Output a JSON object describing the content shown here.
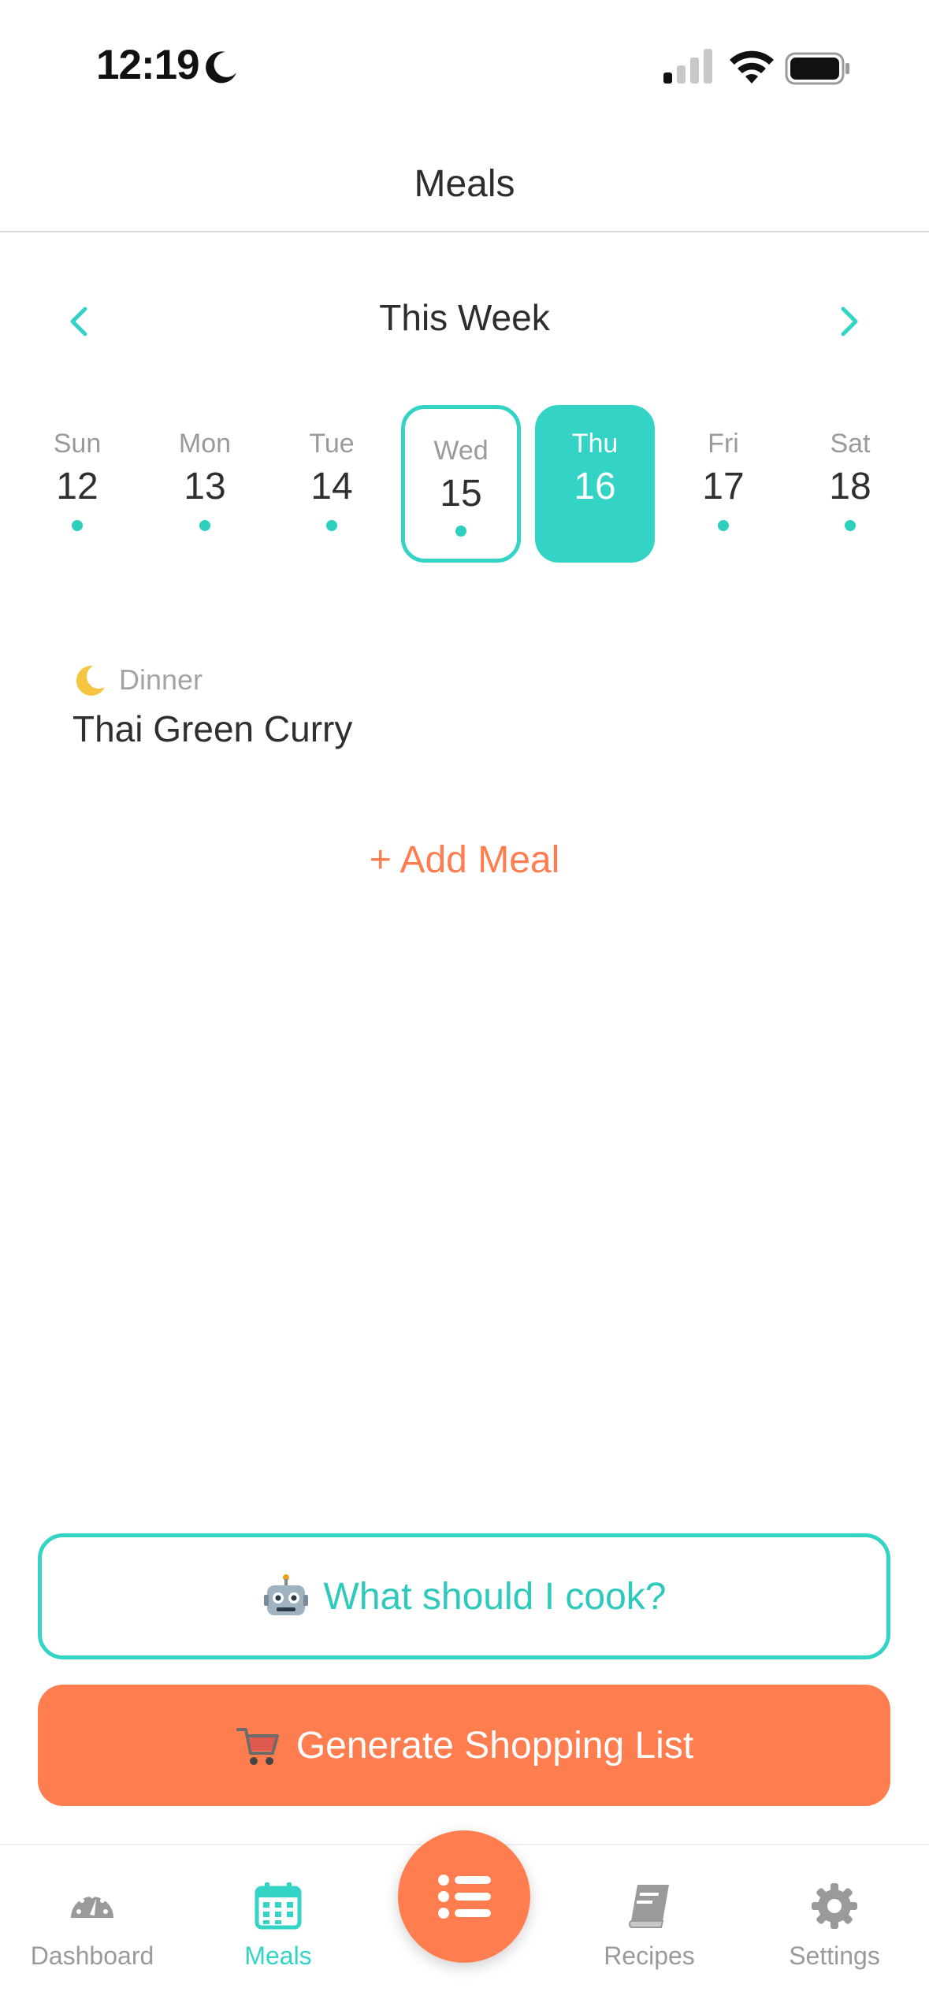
{
  "status_bar": {
    "time": "12:19"
  },
  "header": {
    "title": "Meals"
  },
  "week_nav": {
    "label": "This Week"
  },
  "days": [
    {
      "name": "Sun",
      "number": "12",
      "has_meal": true
    },
    {
      "name": "Mon",
      "number": "13",
      "has_meal": true
    },
    {
      "name": "Tue",
      "number": "14",
      "has_meal": true
    },
    {
      "name": "Wed",
      "number": "15",
      "has_meal": true,
      "today": true
    },
    {
      "name": "Thu",
      "number": "16",
      "has_meal": false,
      "selected": true
    },
    {
      "name": "Fri",
      "number": "17",
      "has_meal": true
    },
    {
      "name": "Sat",
      "number": "18",
      "has_meal": true
    }
  ],
  "meal": {
    "icon": "crescent-moon-icon",
    "type": "Dinner",
    "name": "Thai Green Curry"
  },
  "add_meal_label": "+ Add Meal",
  "actions": {
    "cook_label": "What should I cook?",
    "cook_icon": "robot-icon",
    "shopping_label": "Generate Shopping List",
    "shopping_icon": "shopping-cart-icon"
  },
  "tabs": [
    {
      "label": "Dashboard",
      "icon": "speedometer-icon"
    },
    {
      "label": "Meals",
      "icon": "calendar-icon",
      "active": true
    },
    {
      "label": "Recipes",
      "icon": "book-icon"
    },
    {
      "label": "Settings",
      "icon": "gear-icon"
    }
  ],
  "fab_icon": "list-icon",
  "colors": {
    "accent_teal": "#33d3c5",
    "accent_orange": "#ff7d4f",
    "text_dark": "#2f2f2f",
    "text_muted": "#9a9a9a"
  }
}
